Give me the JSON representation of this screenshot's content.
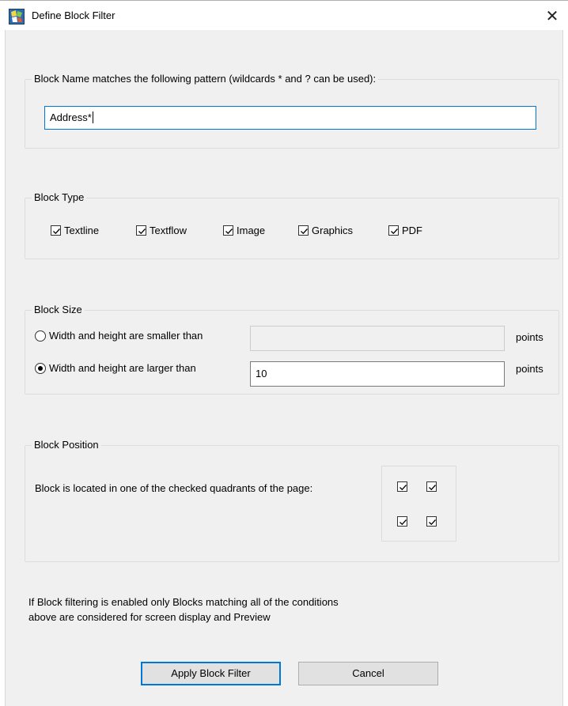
{
  "window": {
    "title": "Define Block Filter",
    "close_glyph": "✕"
  },
  "name_group": {
    "legend": "Block Name matches the following pattern (wildcards * and ? can be used):",
    "pattern_value": "Address*"
  },
  "type_group": {
    "legend": "Block Type",
    "items": [
      {
        "label": "Textline",
        "checked": true
      },
      {
        "label": "Textflow",
        "checked": true
      },
      {
        "label": "Image",
        "checked": true
      },
      {
        "label": "Graphics",
        "checked": true
      },
      {
        "label": "PDF",
        "checked": true
      }
    ]
  },
  "size_group": {
    "legend": "Block Size",
    "smaller_label": "Width and height are smaller than",
    "smaller_value": "",
    "smaller_selected": false,
    "larger_label": "Width and height are larger than",
    "larger_value": "10",
    "larger_selected": true,
    "unit_smaller": "points",
    "unit_larger": "points"
  },
  "position_group": {
    "legend": "Block Position",
    "description": "Block is located in one of the checked quadrants of the page:",
    "quadrants": [
      {
        "name": "top-left",
        "checked": true
      },
      {
        "name": "top-right",
        "checked": true
      },
      {
        "name": "bottom-left",
        "checked": true
      },
      {
        "name": "bottom-right",
        "checked": true
      }
    ]
  },
  "footer": {
    "note_line1": "If Block filtering is enabled only Blocks matching all of the conditions",
    "note_line2": "above are considered for screen display and Preview",
    "apply_label": "Apply Block Filter",
    "cancel_label": "Cancel"
  },
  "colors": {
    "focus_accent": "#0078d7",
    "dialog_background": "#f0f0f0"
  }
}
